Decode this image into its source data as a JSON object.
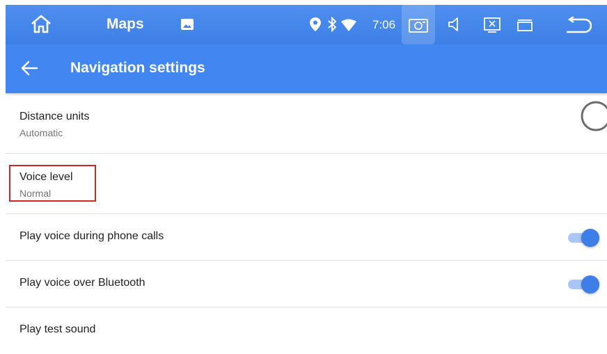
{
  "status_bar": {
    "app_name": "Maps",
    "time": "7:06",
    "icons": [
      "home-icon",
      "gallery-icon",
      "location-icon",
      "bluetooth-icon",
      "wifi-icon",
      "screenshot-icon",
      "volume-icon",
      "screen-icon",
      "window-icon",
      "back-icon"
    ]
  },
  "app_bar": {
    "title": "Navigation settings",
    "back_icon": "arrow-left-icon"
  },
  "settings": {
    "distance_units": {
      "title": "Distance units",
      "value": "Automatic"
    },
    "voice_level": {
      "title": "Voice level",
      "value": "Normal"
    },
    "phone_calls": {
      "title": "Play voice during phone calls",
      "enabled": true
    },
    "bluetooth": {
      "title": "Play voice over Bluetooth",
      "enabled": true
    },
    "test_sound": {
      "title": "Play test sound"
    }
  },
  "colors": {
    "status_bar": "#4f8ff0",
    "app_bar": "#4286f1",
    "toggle_on": "#3d7fe6",
    "highlight": "#d3232a"
  }
}
